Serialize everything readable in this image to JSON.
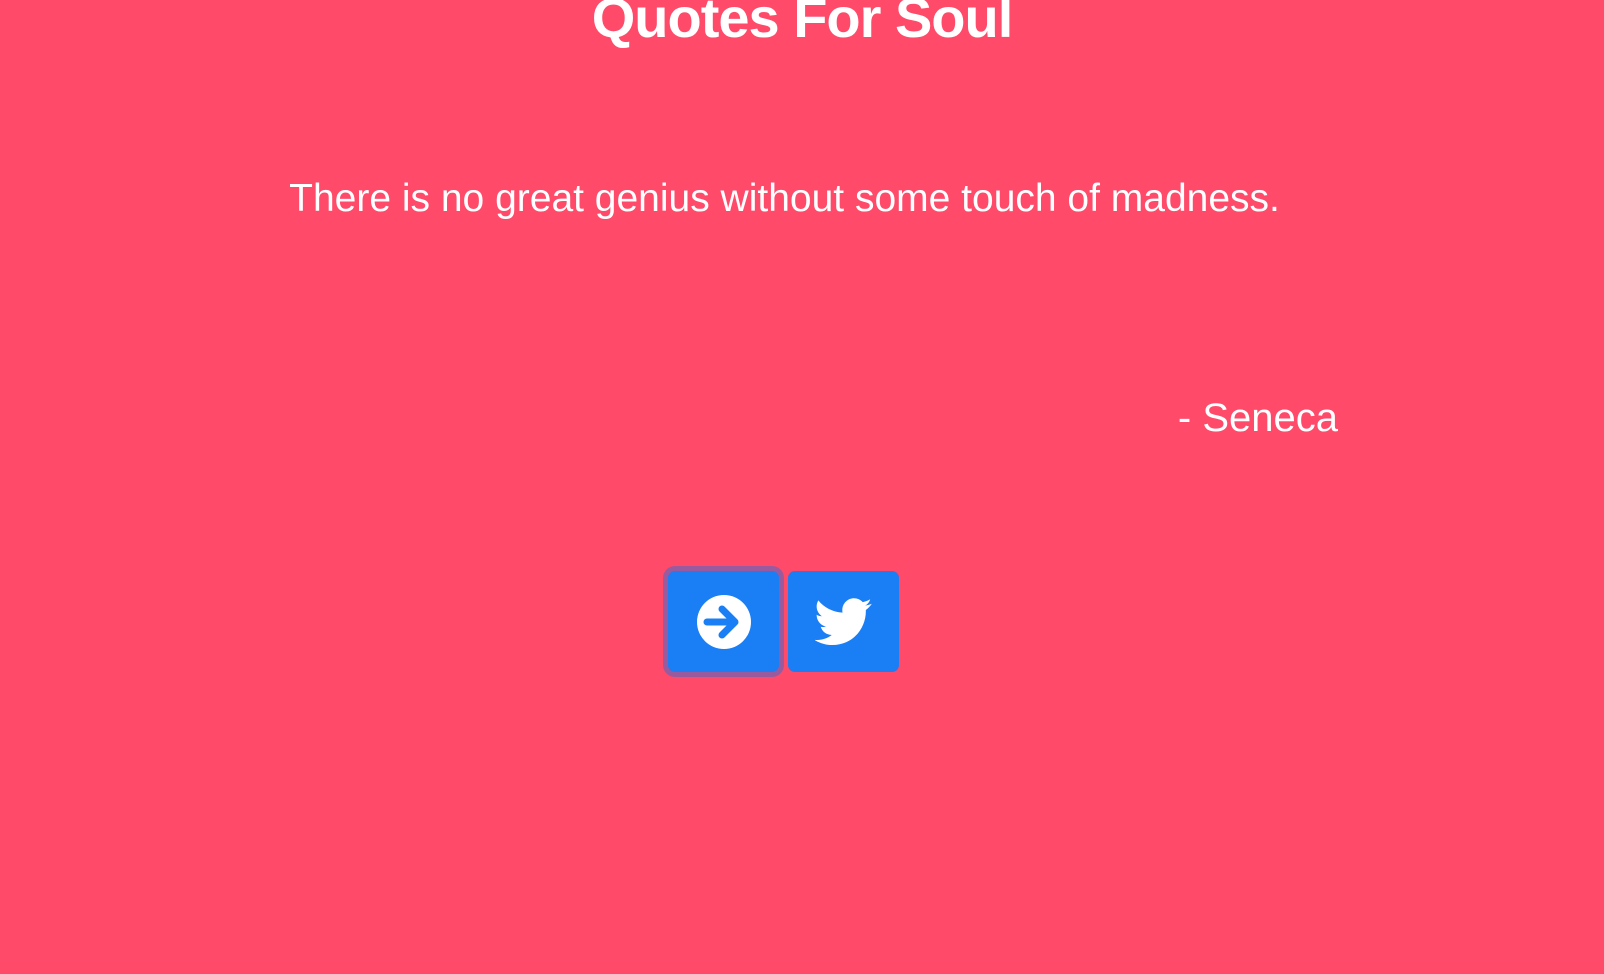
{
  "colors": {
    "background": "#FF4A6A",
    "button": "#1A7EF5",
    "text": "#FFFFFF"
  },
  "header": {
    "title": "Quotes For Soul"
  },
  "quote": {
    "text": "There is no great genius without some touch of madness.",
    "author": "- Seneca"
  },
  "actions": {
    "next_icon": "arrow-circle-right-icon",
    "tweet_icon": "twitter-icon"
  }
}
